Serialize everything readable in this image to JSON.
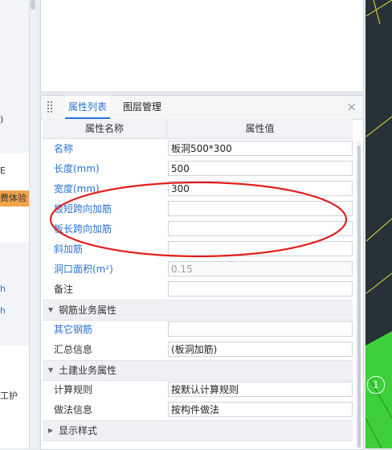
{
  "left_strip": {
    "texts": [
      {
        "text": ")",
        "kind": "dark"
      },
      {
        "text": "E",
        "kind": "dark"
      },
      {
        "text": "费体验",
        "kind": "tag"
      },
      {
        "text": "h",
        "kind": "blue"
      },
      {
        "text": "h",
        "kind": "blue"
      },
      {
        "text": "工护",
        "kind": "dark"
      }
    ]
  },
  "panel": {
    "tabs": [
      {
        "label": "属性列表",
        "active": true
      },
      {
        "label": "图层管理",
        "active": false
      }
    ],
    "close_glyph": "×",
    "header": {
      "name": "属性名称",
      "value": "属性值"
    },
    "rows": [
      {
        "label": "名称",
        "value": "板洞500*300",
        "label_style": "blue",
        "disabled": false
      },
      {
        "label": "长度(mm)",
        "value": "500",
        "label_style": "blue",
        "disabled": false
      },
      {
        "label": "宽度(mm)",
        "value": "300",
        "label_style": "blue",
        "disabled": false
      },
      {
        "label": "板短跨向加筋",
        "value": "",
        "label_style": "blue",
        "disabled": false
      },
      {
        "label": "板长跨向加筋",
        "value": "",
        "label_style": "blue",
        "disabled": false
      },
      {
        "label": "斜加筋",
        "value": "",
        "label_style": "blue",
        "disabled": false
      },
      {
        "label": "洞口面积(m²)",
        "value": "0.15",
        "label_style": "blue",
        "disabled": true
      },
      {
        "label": "备注",
        "value": "",
        "label_style": "dark",
        "disabled": false
      }
    ],
    "group_rebar": {
      "label": "钢筋业务属性",
      "caret": "▼"
    },
    "rows_rebar": [
      {
        "label": "其它钢筋",
        "value": "",
        "label_style": "blue",
        "disabled": false
      },
      {
        "label": "汇总信息",
        "value": "(板洞加筋)",
        "label_style": "dark",
        "disabled": false
      }
    ],
    "group_civil": {
      "label": "土建业务属性",
      "caret": "▼"
    },
    "rows_civil": [
      {
        "label": "计算规则",
        "value": "按默认计算规则",
        "label_style": "dark",
        "disabled": false
      },
      {
        "label": "做法信息",
        "value": "按构件做法",
        "label_style": "dark",
        "disabled": false
      }
    ],
    "group_display": {
      "label": "显示样式",
      "caret": "▶"
    }
  },
  "view3d": {
    "badge_number": "1",
    "colors": {
      "background": "#263238",
      "line": "#e7e23a",
      "green": "#3fcf3a"
    }
  },
  "annotation": {
    "ellipse_color": "#e0201c"
  }
}
